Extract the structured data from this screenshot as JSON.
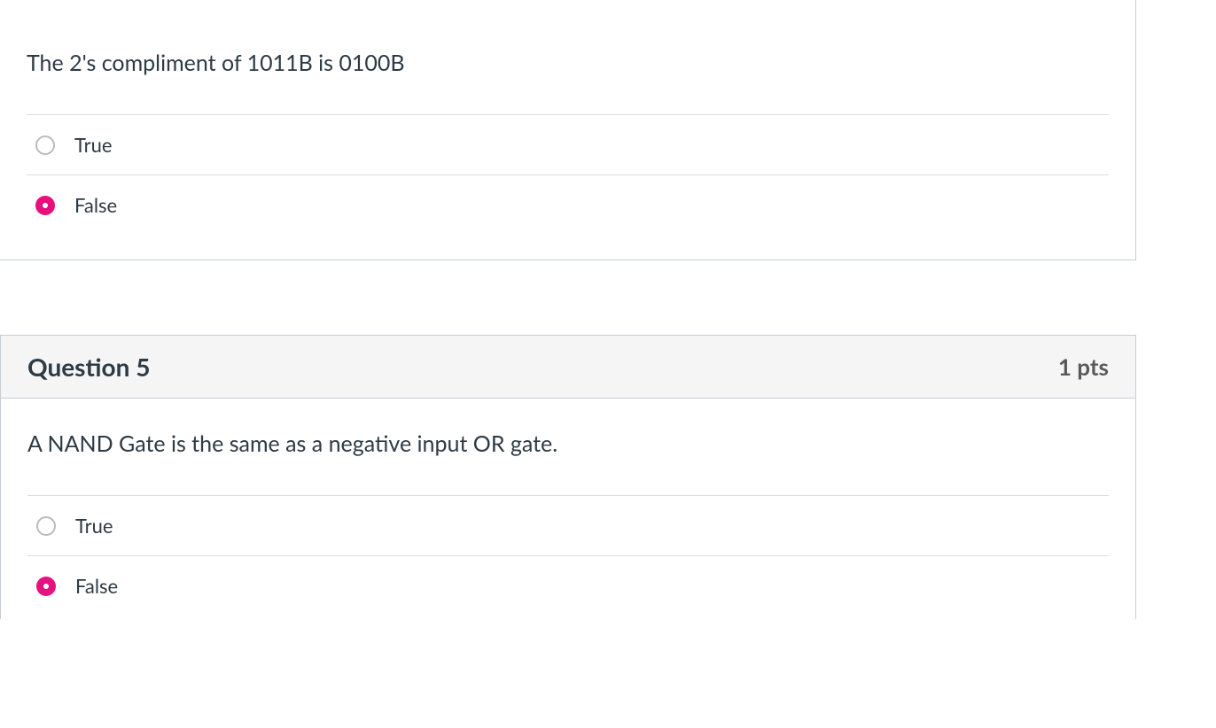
{
  "questions": [
    {
      "text": "The 2's compliment of 1011B is 0100B",
      "options": [
        {
          "label": "True",
          "selected": false
        },
        {
          "label": "False",
          "selected": true
        }
      ]
    },
    {
      "title": "Question 5",
      "points": "1 pts",
      "text": "A NAND Gate is the same as a negative input OR gate.",
      "options": [
        {
          "label": "True",
          "selected": false
        },
        {
          "label": "False",
          "selected": true
        }
      ]
    }
  ]
}
